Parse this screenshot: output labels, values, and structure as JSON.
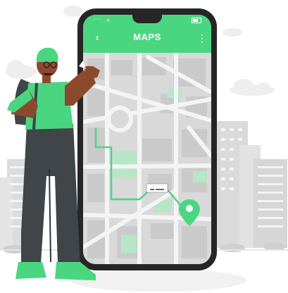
{
  "app": {
    "title": "MAPS",
    "back_icon": "chevron-left-icon",
    "menu_icon": "more-vertical-icon",
    "back_glyph": "‹",
    "menu_glyph": "⋮"
  },
  "status_bar": {
    "time": "·····",
    "signal": "▴"
  },
  "map": {
    "street_sign": "▬ ▬▬",
    "pin_icon": "map-pin-icon",
    "route_color": "#4ad681"
  },
  "colors": {
    "accent": "#4ad681",
    "phone_frame": "#262626",
    "map_block": "#d4d4d4",
    "map_road": "#f5f5f5",
    "park": "#b7e8c8",
    "skin": "#8b4a2e",
    "pants": "#3f4548",
    "buildings": "#dcdcdc"
  }
}
